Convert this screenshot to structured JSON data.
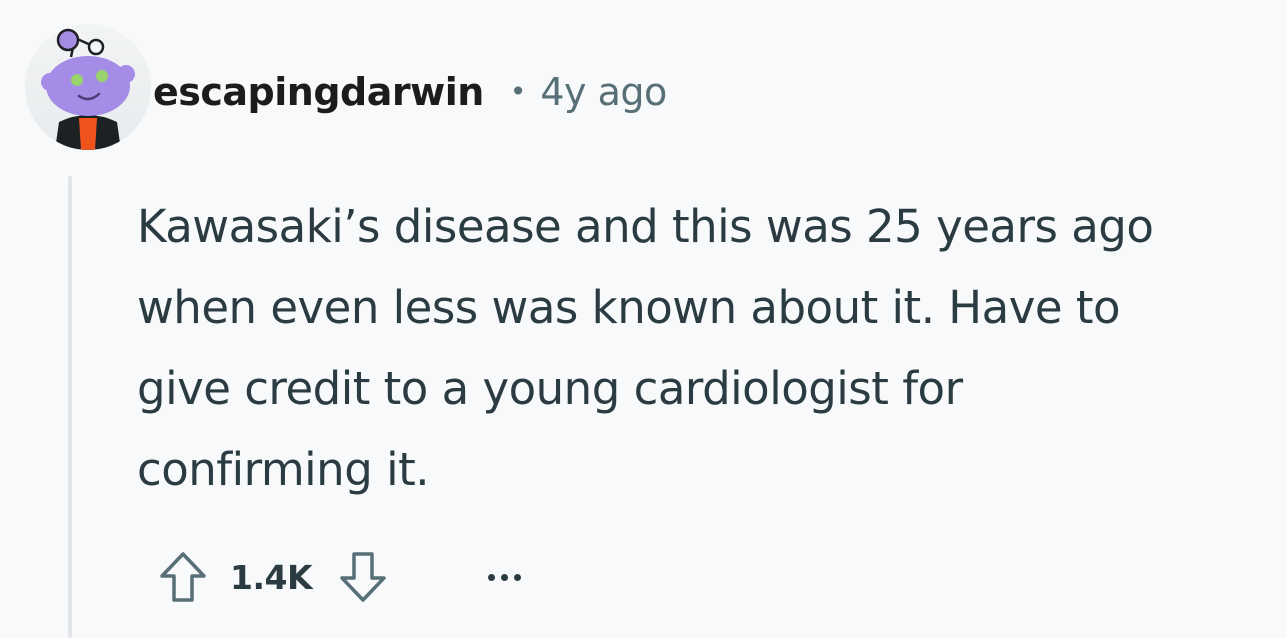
{
  "comment": {
    "author": "escapingdarwin",
    "separator": "•",
    "age": "4y ago",
    "body_lines": [
      "Kawasaki’s disease and this was 25 years ago",
      "when even less was known about it. Have to",
      "give credit to a young cardiologist for",
      "confirming it."
    ],
    "score": "1.4K"
  },
  "icons": {
    "avatar": "snoo-avatar",
    "upvote": "arrow-up-icon",
    "downvote": "arrow-down-icon",
    "more": "ellipsis-icon"
  },
  "colors": {
    "background": "#f8f9fa",
    "text": "#2a3c42",
    "muted": "#576f76",
    "avatar_purple": "#a58ce6",
    "avatar_orange": "#f0541e",
    "thread_line": "#e2e5e8"
  }
}
